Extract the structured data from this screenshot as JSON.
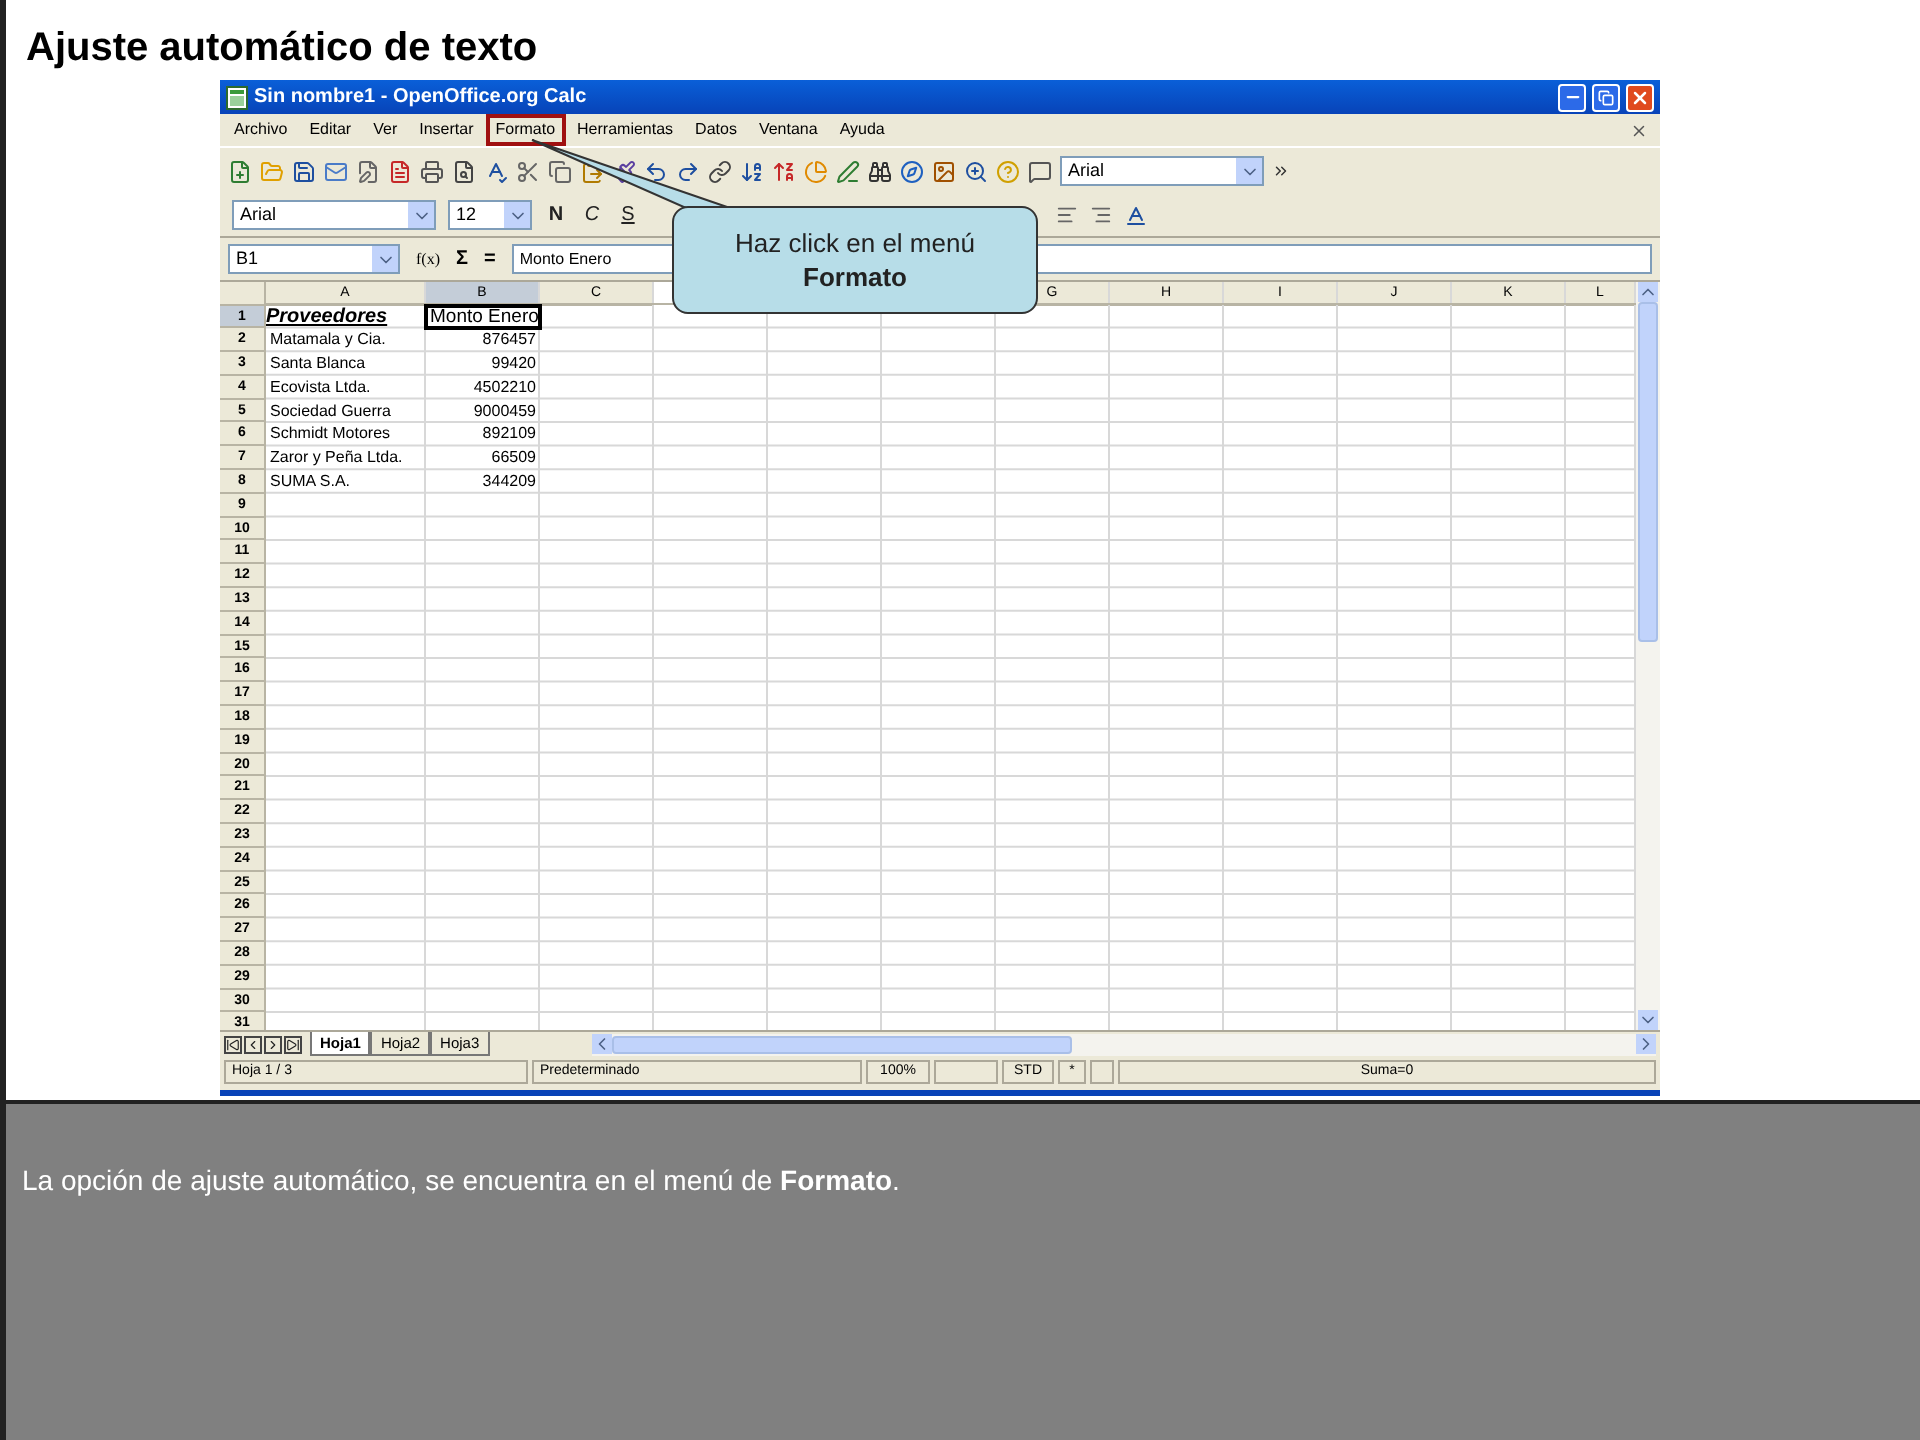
{
  "slide_title": "Ajuste automático de texto",
  "window": {
    "title": "Sin nombre1 - OpenOffice.org Calc"
  },
  "menu": [
    {
      "label": "Archivo",
      "selected": false
    },
    {
      "label": "Editar",
      "selected": false
    },
    {
      "label": "Ver",
      "selected": false
    },
    {
      "label": "Insertar",
      "selected": false
    },
    {
      "label": "Formato",
      "selected": true
    },
    {
      "label": "Herramientas",
      "selected": false
    },
    {
      "label": "Datos",
      "selected": false
    },
    {
      "label": "Ventana",
      "selected": false
    },
    {
      "label": "Ayuda",
      "selected": false
    }
  ],
  "toolbar": {
    "font_search": "Arial"
  },
  "format_toolbar": {
    "font": "Arial",
    "size": "12",
    "styles": [
      {
        "label": "N",
        "kind": "bold"
      },
      {
        "label": "C",
        "kind": "italic"
      },
      {
        "label": "S",
        "kind": "underline"
      }
    ]
  },
  "formula_bar": {
    "name_box": "B1",
    "function_wizard": "f(x)",
    "sum": "Σ",
    "equals": "=",
    "value": "Monto Enero"
  },
  "columns_left": [
    {
      "label": "A",
      "selected": false
    },
    {
      "label": "B",
      "selected": true
    },
    {
      "label": "C",
      "selected": false
    }
  ],
  "columns_right": [
    {
      "label": "G",
      "selected": false
    },
    {
      "label": "H",
      "selected": false
    },
    {
      "label": "I",
      "selected": false
    },
    {
      "label": "J",
      "selected": false
    },
    {
      "label": "K",
      "selected": false
    },
    {
      "label": "L",
      "selected": false
    }
  ],
  "rows": [
    {
      "label": "1",
      "selected": true,
      "cells": [
        {
          "text": "Proveedores",
          "kind": "header",
          "selected": false
        },
        {
          "text": "Monto Enero",
          "kind": "text",
          "selected": true
        }
      ]
    },
    {
      "label": "2",
      "selected": false,
      "cells": [
        {
          "text": "Matamala y Cia.",
          "kind": "text",
          "selected": false
        },
        {
          "text": "876457",
          "kind": "number",
          "selected": false
        }
      ]
    },
    {
      "label": "3",
      "selected": false,
      "cells": [
        {
          "text": "Santa Blanca",
          "kind": "text",
          "selected": false
        },
        {
          "text": "99420",
          "kind": "number",
          "selected": false
        }
      ]
    },
    {
      "label": "4",
      "selected": false,
      "cells": [
        {
          "text": "Ecovista Ltda.",
          "kind": "text",
          "selected": false
        },
        {
          "text": "4502210",
          "kind": "number",
          "selected": false
        }
      ]
    },
    {
      "label": "5",
      "selected": false,
      "cells": [
        {
          "text": "Sociedad Guerra",
          "kind": "text",
          "selected": false
        },
        {
          "text": "9000459",
          "kind": "number",
          "selected": false
        }
      ]
    },
    {
      "label": "6",
      "selected": false,
      "cells": [
        {
          "text": "Schmidt Motores",
          "kind": "text",
          "selected": false
        },
        {
          "text": "892109",
          "kind": "number",
          "selected": false
        }
      ]
    },
    {
      "label": "7",
      "selected": false,
      "cells": [
        {
          "text": "Zaror y Peña Ltda.",
          "kind": "text",
          "selected": false
        },
        {
          "text": "66509",
          "kind": "number",
          "selected": false
        }
      ]
    },
    {
      "label": "8",
      "selected": false,
      "cells": [
        {
          "text": "SUMA S.A.",
          "kind": "text",
          "selected": false
        },
        {
          "text": "344209",
          "kind": "number",
          "selected": false
        }
      ]
    },
    {
      "label": "9",
      "selected": false,
      "cells": []
    },
    {
      "label": "10",
      "selected": false,
      "cells": []
    },
    {
      "label": "11",
      "selected": false,
      "cells": []
    },
    {
      "label": "12",
      "selected": false,
      "cells": []
    },
    {
      "label": "13",
      "selected": false,
      "cells": []
    },
    {
      "label": "14",
      "selected": false,
      "cells": []
    },
    {
      "label": "15",
      "selected": false,
      "cells": []
    },
    {
      "label": "16",
      "selected": false,
      "cells": []
    },
    {
      "label": "17",
      "selected": false,
      "cells": []
    },
    {
      "label": "18",
      "selected": false,
      "cells": []
    },
    {
      "label": "19",
      "selected": false,
      "cells": []
    },
    {
      "label": "20",
      "selected": false,
      "cells": []
    },
    {
      "label": "21",
      "selected": false,
      "cells": []
    },
    {
      "label": "22",
      "selected": false,
      "cells": []
    },
    {
      "label": "23",
      "selected": false,
      "cells": []
    },
    {
      "label": "24",
      "selected": false,
      "cells": []
    },
    {
      "label": "25",
      "selected": false,
      "cells": []
    },
    {
      "label": "26",
      "selected": false,
      "cells": []
    },
    {
      "label": "27",
      "selected": false,
      "cells": []
    },
    {
      "label": "28",
      "selected": false,
      "cells": []
    },
    {
      "label": "29",
      "selected": false,
      "cells": []
    },
    {
      "label": "30",
      "selected": false,
      "cells": []
    },
    {
      "label": "31",
      "selected": false,
      "cells": []
    }
  ],
  "sheet_tabs": [
    {
      "label": "Hoja1",
      "selected": true
    },
    {
      "label": "Hoja2",
      "selected": false
    },
    {
      "label": "Hoja3",
      "selected": false
    }
  ],
  "status_bar": [
    "Hoja 1 / 3",
    "Predeterminado",
    "100%",
    "STD",
    "*",
    "Suma=0"
  ],
  "callout": {
    "text": "Haz click en el menú",
    "bold_text": "Formato"
  },
  "caption": "La opción de ajuste automático, se encuentra en el menú de **Formato**."
}
